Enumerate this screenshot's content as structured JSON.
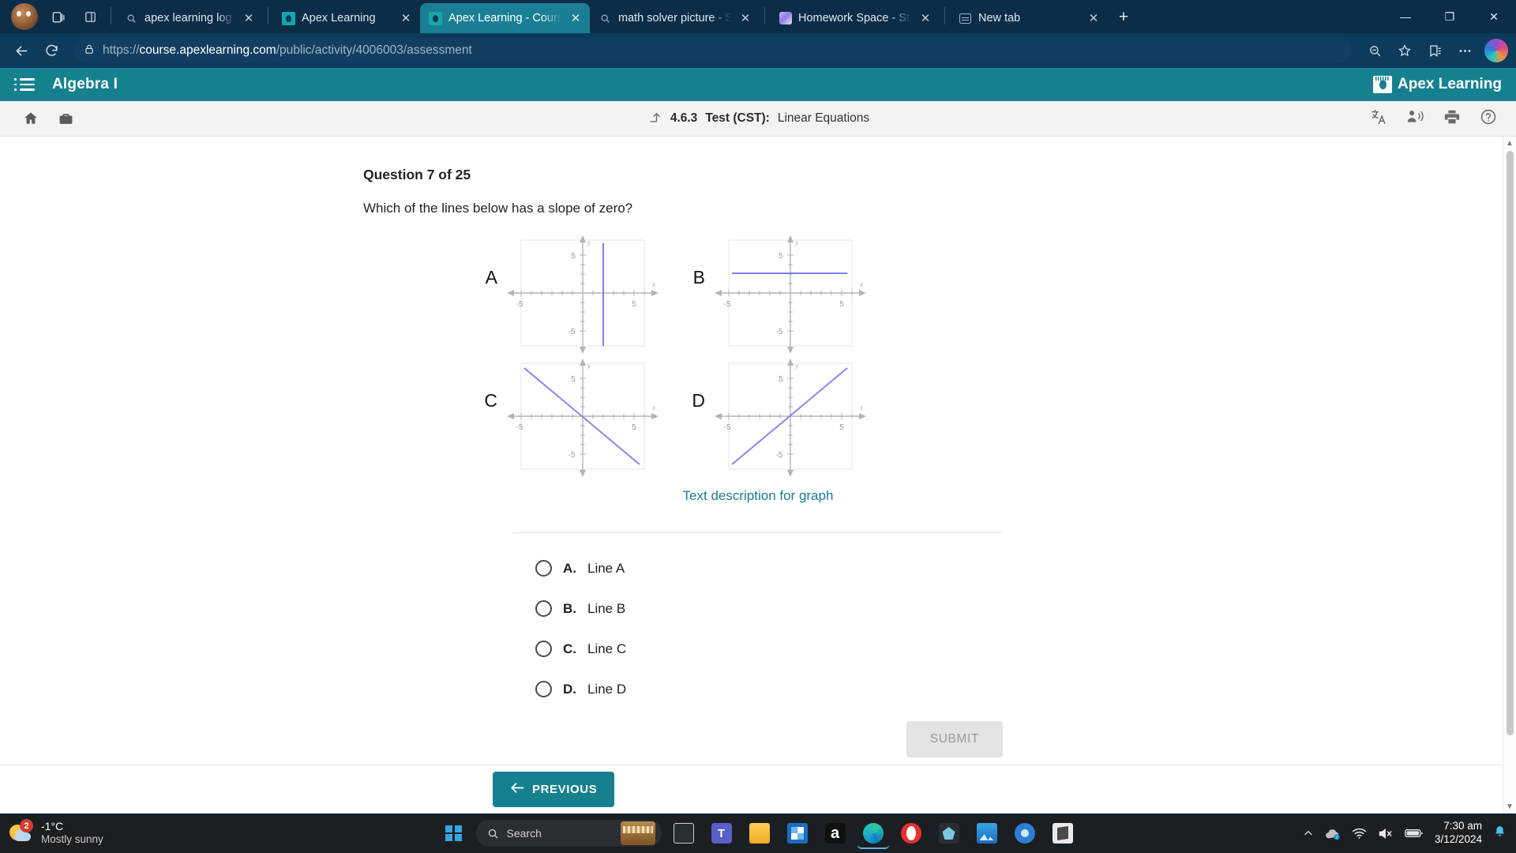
{
  "browser": {
    "tabs": [
      {
        "title": "apex learning log in - Sea",
        "icon": "search-icon",
        "active": false
      },
      {
        "title": "Apex Learning",
        "icon": "apex-favicon",
        "active": false
      },
      {
        "title": "Apex Learning - Courses",
        "icon": "apex-favicon",
        "active": true
      },
      {
        "title": "math solver picture - Sear",
        "icon": "search-icon",
        "active": false
      },
      {
        "title": "Homework Space - Study",
        "icon": "homework-space-favicon",
        "active": false
      },
      {
        "title": "New tab",
        "icon": "new-tab-favicon",
        "active": false
      }
    ],
    "new_tab_label": "+",
    "window_controls": {
      "minimize": "—",
      "maximize": "❐",
      "close": "✕"
    },
    "url": {
      "scheme": "https://",
      "domain": "course.apexlearning.com",
      "path": "/public/activity/4006003/assessment",
      "full": "https://course.apexlearning.com/public/activity/4006003/assessment"
    },
    "icons": {
      "profile": "profile-avatar",
      "collections": "collections-icon",
      "split_screen": "split-screen-icon",
      "back": "back-arrow-icon",
      "refresh": "refresh-icon",
      "lock": "lock-icon",
      "zoom_out": "zoom-out-icon",
      "favorite": "star-icon",
      "favorites_bar": "favorites-icon",
      "more": "more-options-icon",
      "copilot": "copilot-icon"
    }
  },
  "apex_header": {
    "menu_icon": "hamburger-menu-icon",
    "course_title": "Algebra I",
    "logo_text": "Apex Learning"
  },
  "apex_subheader": {
    "home_icon": "home-icon",
    "briefcase_icon": "briefcase-icon",
    "up_arrow_icon": "up-level-icon",
    "lesson_code": "4.6.3",
    "lesson_type": "Test (CST):",
    "lesson_name": "Linear Equations",
    "right_icons": [
      {
        "name": "translate-icon",
        "glyph": "文A"
      },
      {
        "name": "read-aloud-icon",
        "glyph": "read"
      },
      {
        "name": "print-icon",
        "glyph": "print"
      },
      {
        "name": "help-icon",
        "glyph": "?"
      }
    ]
  },
  "question": {
    "heading": "Question 7 of 25",
    "number": 7,
    "total": 25,
    "prompt": "Which of the lines below has a slope of zero?",
    "text_description_link": "Text description for graph"
  },
  "graphs": [
    {
      "label": "A",
      "description": "vertical line at x = 2",
      "x_tick_left": "-5",
      "x_tick_right": "5",
      "y_tick_up": "5",
      "y_tick_down": "-5",
      "x_axis_label": "x",
      "y_axis_label": "y"
    },
    {
      "label": "B",
      "description": "horizontal line at y = 2",
      "x_tick_left": "-5",
      "x_tick_right": "5",
      "y_tick_up": "5",
      "y_tick_down": "-5",
      "x_axis_label": "x",
      "y_axis_label": "y"
    },
    {
      "label": "C",
      "description": "line with negative slope through origin",
      "x_tick_left": "-5",
      "x_tick_right": "5",
      "y_tick_up": "5",
      "y_tick_down": "-5",
      "x_axis_label": "x",
      "y_axis_label": "y"
    },
    {
      "label": "D",
      "description": "line with positive slope through origin",
      "x_tick_left": "-5",
      "x_tick_right": "5",
      "y_tick_up": "5",
      "y_tick_down": "-5",
      "x_axis_label": "x",
      "y_axis_label": "y"
    }
  ],
  "choices": [
    {
      "letter": "A.",
      "text": "Line A",
      "selected": false
    },
    {
      "letter": "B.",
      "text": "Line B",
      "selected": false
    },
    {
      "letter": "C.",
      "text": "Line C",
      "selected": false
    },
    {
      "letter": "D.",
      "text": "Line D",
      "selected": false
    }
  ],
  "actions": {
    "submit_label": "SUBMIT",
    "submit_enabled": false,
    "previous_label": "PREVIOUS"
  },
  "taskbar": {
    "weather": {
      "temperature": "-1°C",
      "condition": "Mostly sunny",
      "badge": "2"
    },
    "search_placeholder": "Search",
    "apps": [
      {
        "name": "start-button"
      },
      {
        "name": "search-box"
      },
      {
        "name": "task-view-button"
      },
      {
        "name": "teams-app"
      },
      {
        "name": "file-explorer-app"
      },
      {
        "name": "microsoft-store-app"
      },
      {
        "name": "amazon-app"
      },
      {
        "name": "edge-browser-app"
      },
      {
        "name": "opera-browser-app"
      },
      {
        "name": "extension-app"
      },
      {
        "name": "photos-app"
      },
      {
        "name": "settings-app"
      },
      {
        "name": "unknown-app"
      }
    ],
    "tray": {
      "chevron": "show-hidden-icons",
      "onedrive": "onedrive-icon",
      "wifi": "wifi-icon",
      "volume": "volume-muted-icon",
      "battery": "battery-icon"
    },
    "time": "7:30 am",
    "date": "3/12/2024",
    "notification_icon": "notification-bell-icon"
  },
  "colors": {
    "apex_teal": "#15818f",
    "browser_dark": "#0c2d48",
    "nav_dark": "#0d3b5c",
    "link_teal": "#1c7b94",
    "graph_line": "#7b7bea",
    "taskbar": "#1c1f22"
  }
}
